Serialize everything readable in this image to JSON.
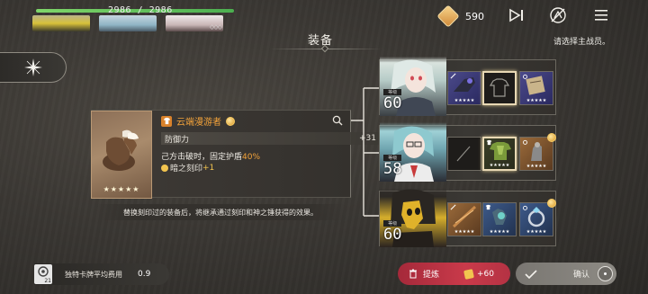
{
  "party": {
    "hp_text": "2986 / 2986",
    "hp_fraction": 1.0,
    "slots_diamonds": "◇◇◇"
  },
  "currency": {
    "value": "590"
  },
  "header": {
    "title": "装备",
    "hint": "请选择主战员。"
  },
  "detail": {
    "name": "云端漫游者",
    "stat_label": "防御力",
    "stat_value": "+31",
    "desc_prefix": "己方击破时，固定护盾",
    "desc_highlight": "40%",
    "seal_label": "暗之刻印",
    "seal_plus": "+1",
    "stars": "★★★★★"
  },
  "footnote": "替换刻印过的装备后，将继承通过刻印和神之锤获得的效果。",
  "characters": [
    {
      "level_label": "等级",
      "level": "60",
      "slot_stars": [
        "★★★★★",
        "",
        "★★★★★"
      ]
    },
    {
      "level_label": "等级",
      "level": "58",
      "slot_stars": [
        "",
        "★★★★★",
        "★★★★★"
      ]
    },
    {
      "level_label": "等级",
      "level": "60",
      "slot_stars": [
        "★★★★★",
        "★★★★★",
        "★★★★★"
      ]
    }
  ],
  "bottom": {
    "card_number": "21",
    "cost_label": "独特卡牌平均费用",
    "cost_value": "0.9",
    "refine_label": "提炼",
    "refine_gain": "+60",
    "confirm_label": "确认"
  },
  "colors": {
    "accent_orange": "#f2a23a",
    "refine_red": "#c93a4a",
    "confirm_gray": "#8d8a84",
    "hp_green": "#7fd66a"
  },
  "icons": [
    "skip-icon",
    "auto-off-icon",
    "menu-icon",
    "sparkle-icon",
    "search-icon",
    "trash-icon",
    "check-icon",
    "shield-icon",
    "ring-icon",
    "weapon-icon"
  ]
}
